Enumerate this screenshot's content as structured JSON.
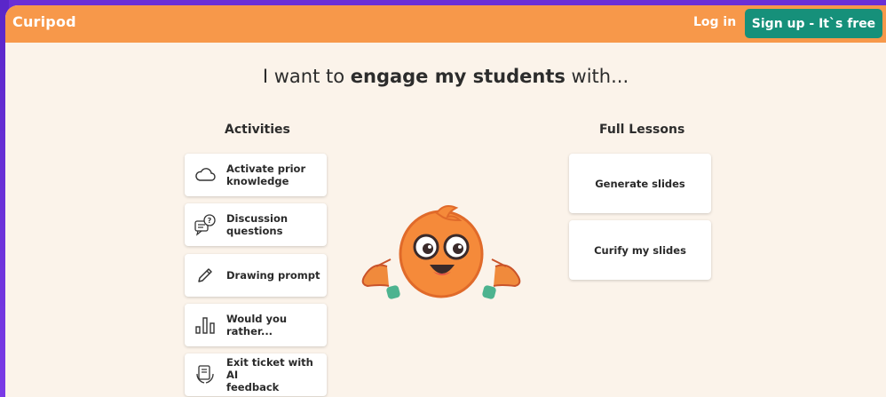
{
  "header": {
    "logo": "Curipod",
    "login_label": "Log in",
    "signup_label": "Sign up - It`s free"
  },
  "headline": {
    "prefix": "I want to ",
    "bold": "engage my students",
    "suffix": " with..."
  },
  "activities": {
    "title": "Activities",
    "items": [
      {
        "label_1": "Activate prior",
        "label_2": "knowledge",
        "icon": "cloud-icon"
      },
      {
        "label_1": "Discussion",
        "label_2": "questions",
        "icon": "discussion-icon"
      },
      {
        "label_1": "Drawing prompt",
        "label_2": "",
        "icon": "pencil-icon"
      },
      {
        "label_1": "Would you",
        "label_2": "rather...",
        "icon": "bar-chart-icon"
      },
      {
        "label_1": "Exit ticket with AI",
        "label_2": "feedback",
        "icon": "exit-ticket-icon"
      }
    ]
  },
  "full_lessons": {
    "title": "Full Lessons",
    "items": [
      {
        "label": "Generate slides"
      },
      {
        "label": "Curify my slides"
      }
    ]
  },
  "colors": {
    "header": "#f7984a",
    "signup": "#16907a",
    "background": "#fbf3ea",
    "purple": "#6b2fd6"
  }
}
